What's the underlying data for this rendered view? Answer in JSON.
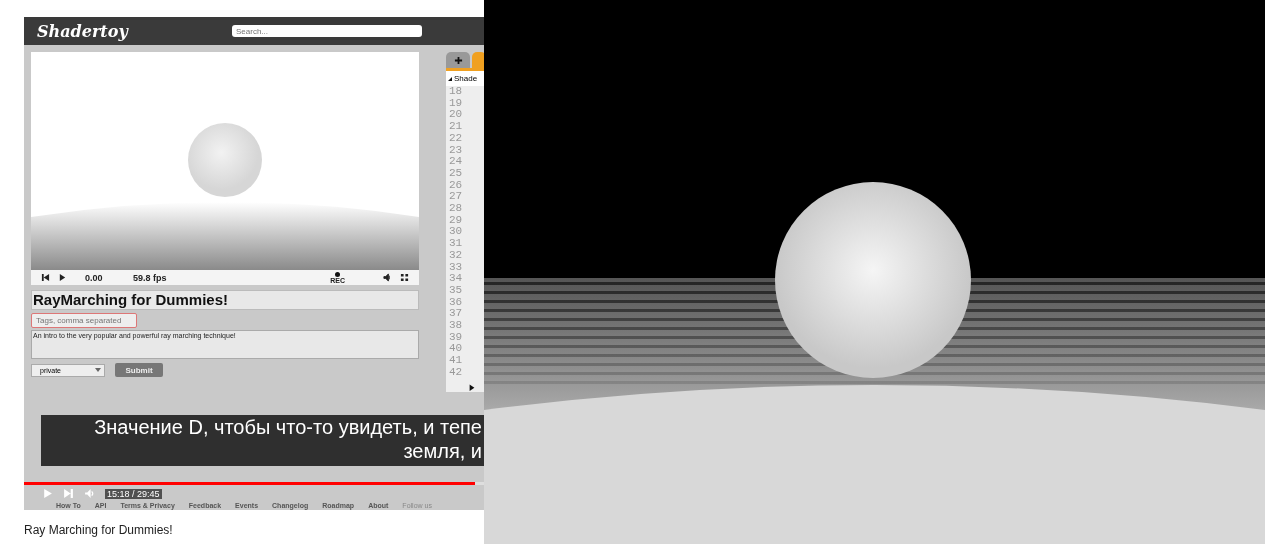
{
  "shadertoy": {
    "logo": "Shadertoy",
    "search_placeholder": "Search...",
    "player": {
      "time": "0.00",
      "fps": "59.8 fps",
      "rec": "REC"
    },
    "title": "RayMarching for Dummies!",
    "tags_placeholder": "Tags, comma separated",
    "description": "An intro to the very popular and powerful ray marching technique!",
    "visibility": "private",
    "submit": "Submit",
    "editor": {
      "tab": "Shade",
      "line_numbers": [
        "18",
        "19",
        "20",
        "21",
        "22",
        "23",
        "24",
        "25",
        "26",
        "27",
        "28",
        "29",
        "30",
        "31",
        "32",
        "33",
        "34",
        "35",
        "36",
        "37",
        "38",
        "39",
        "40",
        "41",
        "42"
      ]
    },
    "footer_links": [
      "How To",
      "API",
      "Terms & Privacy",
      "Feedback",
      "Events",
      "Changelog",
      "Roadmap",
      "About"
    ],
    "follow": "Follow us"
  },
  "subtitles": [
    "Значение D, чтобы что-то увидеть, и тепе",
    "земля, и"
  ],
  "video_controls": {
    "level": 0.98,
    "time": "15:18 / 29:45"
  },
  "video_title": "Ray Marching for Dummies!"
}
